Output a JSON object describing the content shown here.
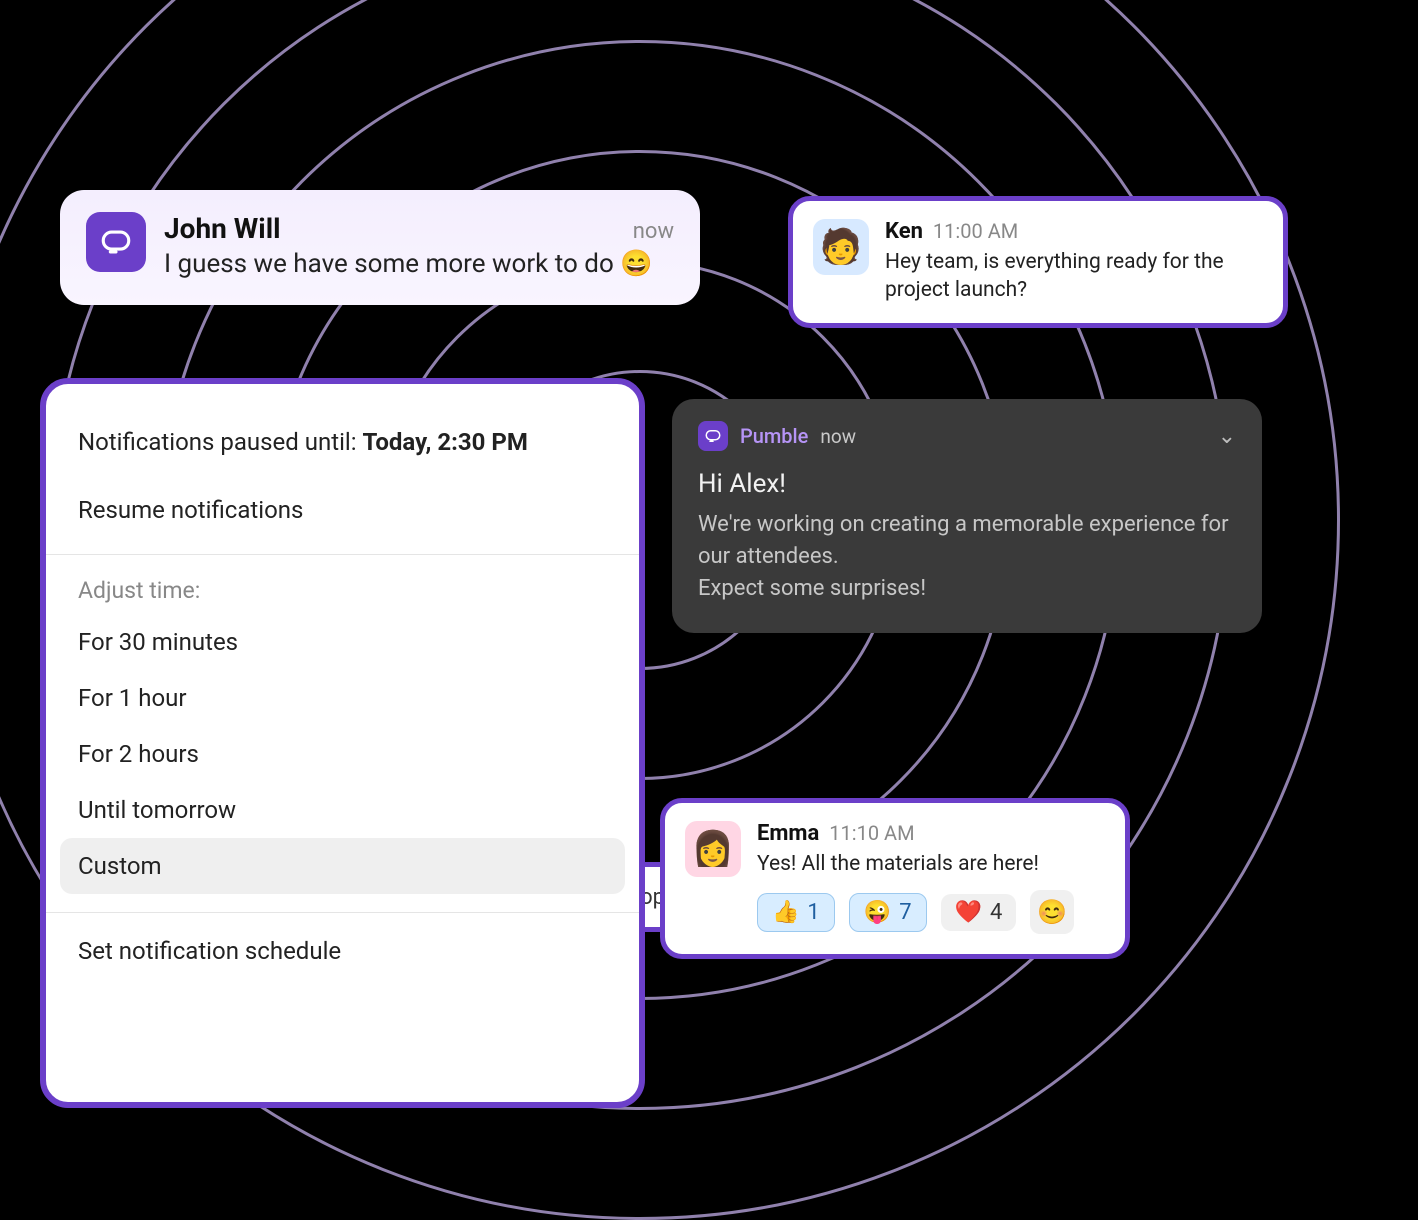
{
  "john": {
    "name": "John Will",
    "time": "now",
    "message": "I guess we have some more work to do 😄"
  },
  "ken": {
    "name": "Ken",
    "time": "11:00 AM",
    "message": "Hey team, is everything ready for the project launch?"
  },
  "settings": {
    "paused_prefix": "Notifications paused until: ",
    "paused_value": "Today, 2:30 PM",
    "resume": "Resume notifications",
    "adjust_label": "Adjust time:",
    "options": {
      "o0": "For 30 minutes",
      "o1": "For 1 hour",
      "o2": "For 2 hours",
      "o3": "Until tomorrow",
      "o4": "Custom"
    },
    "schedule": "Set notification schedule"
  },
  "topic_peek": "topic",
  "push": {
    "app": "Pumble",
    "when": "now",
    "title": "Hi Alex!",
    "line1": "We're working on creating a memorable experience for our attendees.",
    "line2": "Expect some surprises!"
  },
  "emma": {
    "name": "Emma",
    "time": "11:10 AM",
    "message": "Yes! All the materials are here!",
    "reactions": {
      "r0": {
        "emoji": "👍",
        "count": "1"
      },
      "r1": {
        "emoji": "😜",
        "count": "7"
      },
      "r2": {
        "emoji": "❤️",
        "count": "4"
      }
    }
  }
}
